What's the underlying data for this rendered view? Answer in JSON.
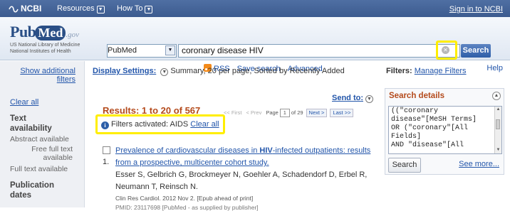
{
  "topbar": {
    "brand": "NCBI",
    "menu_resources": "Resources",
    "menu_howto": "How To",
    "sign_in": "Sign in to NCBI"
  },
  "header": {
    "logo_pub": "Pub",
    "logo_med": "Med",
    "logo_gov": ".gov",
    "logo_sub1": "US National Library of Medicine",
    "logo_sub2": "National Institutes of Health",
    "database": "PubMed",
    "query": "coronary disease HIV",
    "search_button": "Search",
    "links": {
      "rss": "RSS",
      "save_search": "Save search",
      "advanced": "Advanced"
    },
    "help": "Help"
  },
  "sidebar": {
    "show_filters": "Show additional filters",
    "clear_all": "Clear all",
    "text_availability": "Text availability",
    "abstract_available": "Abstract available",
    "free_full_text": "Free full text available",
    "full_text_available": "Full text available",
    "publication_dates": "Publication dates"
  },
  "main": {
    "display_settings_label": "Display Settings:",
    "display_settings_value": "Summary, 20 per page, Sorted by Recently Added",
    "send_to": "Send to:",
    "results_header": "Results: 1 to 20 of 567",
    "pager": {
      "first": "<< First",
      "prev": "< Prev",
      "page_label": "Page",
      "page_value": "1",
      "of_pages": "of 29",
      "next": "Next >",
      "last": "Last >>"
    },
    "filters_activated": "Filters activated: AIDS",
    "filters_clear_all": "Clear all",
    "result": {
      "number": "1.",
      "title_pre": "Prevalence of cardiovascular diseases in ",
      "title_bold": "HIV",
      "title_post": "-infected outpatients: results from a prospective, multicenter cohort study.",
      "authors": "Esser S, Gelbrich G, Brockmeyer N, Goehler A, Schadendorf D, Erbel R, Neumann T, Reinsch N.",
      "journal": "Clin Res Cardiol. 2012 Nov 2. [Epub ahead of print]",
      "pmid": "PMID: 23117698 [PubMed - as supplied by publisher]"
    }
  },
  "right": {
    "filters_label": "Filters:",
    "manage_filters": "Manage Filters",
    "search_details_title": "Search details",
    "search_details_text": "((\"coronary\ndisease\"[MeSH Terms]\nOR (\"coronary\"[All\nFields]\nAND \"disease\"[All",
    "search_button": "Search",
    "see_more": "See more..."
  },
  "colors": {
    "topbar": "#3c5b8f",
    "link": "#2255aa",
    "results_header": "#b44a1b",
    "highlight": "#ffee00"
  }
}
